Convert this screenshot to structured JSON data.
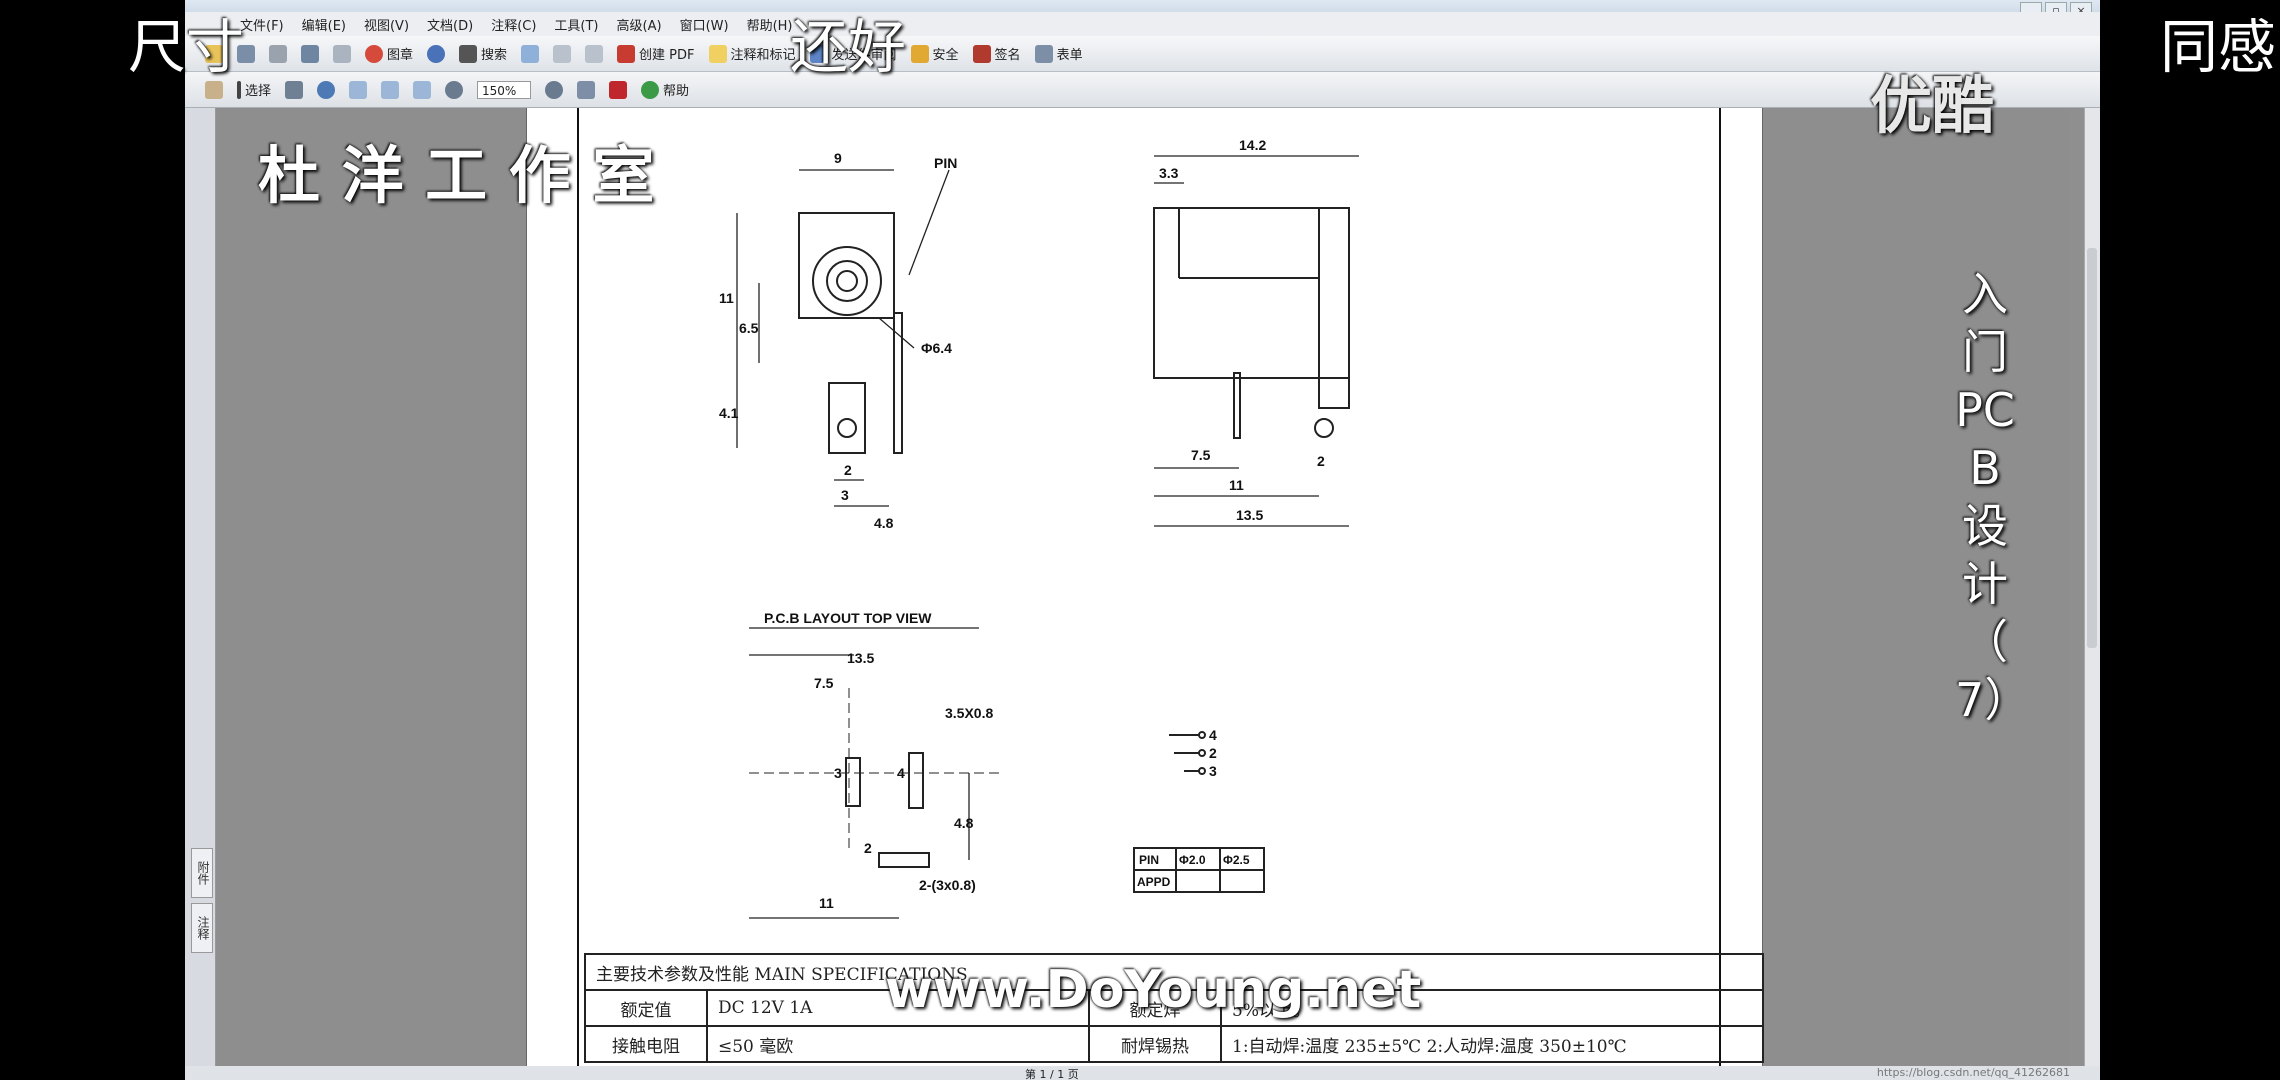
{
  "app": {
    "menu": [
      "文件(F)",
      "编辑(E)",
      "视图(V)",
      "文档(D)",
      "注释(C)",
      "工具(T)",
      "高级(A)",
      "窗口(W)",
      "帮助(H)"
    ],
    "toolbar1": [
      {
        "label": "图章",
        "icon": "stamp-icon"
      },
      {
        "label": "搜索",
        "icon": "binoculars-icon"
      },
      {
        "label": "创建 PDF",
        "icon": "create-pdf-icon"
      },
      {
        "label": "注释和标记",
        "icon": "comment-icon"
      },
      {
        "label": "发送供审阅",
        "icon": "send-review-icon"
      },
      {
        "label": "安全",
        "icon": "lock-icon"
      },
      {
        "label": "签名",
        "icon": "pen-icon"
      },
      {
        "label": "表单",
        "icon": "form-icon"
      }
    ],
    "toolbar2": {
      "select_label": "选择",
      "zoom": "150%",
      "help_label": "帮助"
    },
    "left_tabs": [
      "附件",
      "注释"
    ],
    "status_page": "第 1 / 1 页",
    "status_watermark": "https://blog.csdn.net/qq_41262681"
  },
  "drawing": {
    "front": {
      "top": "9",
      "pin": "PIN",
      "left_total": "11",
      "left_mid": "6.5",
      "left_bottom": "4.1",
      "diameter": "Φ6.4",
      "pin_width": "2",
      "bottom_small": "3",
      "bottom_right": "4.8"
    },
    "side": {
      "top_total": "14.2",
      "top_left": "3.3",
      "b1": "7.5",
      "b2": "2",
      "b3": "11",
      "b4": "13.5"
    },
    "pcb": {
      "title": "P.C.B LAYOUT     TOP VIEW",
      "top": "13.5",
      "top_sub": "7.5",
      "pad_label": "3.5X0.8",
      "pin3": "3",
      "pin4": "4",
      "pin2": "2",
      "pad2": "2-(3x0.8)",
      "height": "4.8",
      "bottom": "11"
    },
    "schematic": {
      "p4": "4",
      "p2": "2",
      "p3": "3"
    },
    "pin_table": {
      "h1": "PIN",
      "h2": "Φ2.0",
      "h3": "Φ2.5",
      "r1": "APPD"
    }
  },
  "spec_table": {
    "title": "主要技术参数及性能 MAIN SPECIFICATIONS",
    "r1c1": "额定值",
    "r1c2": "DC 12V 1A",
    "r1c3": "额定焊",
    "r1c4": "5%以上。",
    "r2c1": "接触电阻",
    "r2c2": "≤50 毫欧",
    "r2c3": "耐焊锡热",
    "r2c4": "1:自动焊:温度 235±5℃ 2:人动焊:温度 350±10℃"
  },
  "overlays": {
    "top_left": "尺寸",
    "top_mid": "还好",
    "top_right": "同感",
    "studio": "杜 洋 工 作 室",
    "logo": "优酷",
    "vertical": "入门PCB设计（7）",
    "site": "www.DoYoung.net"
  }
}
